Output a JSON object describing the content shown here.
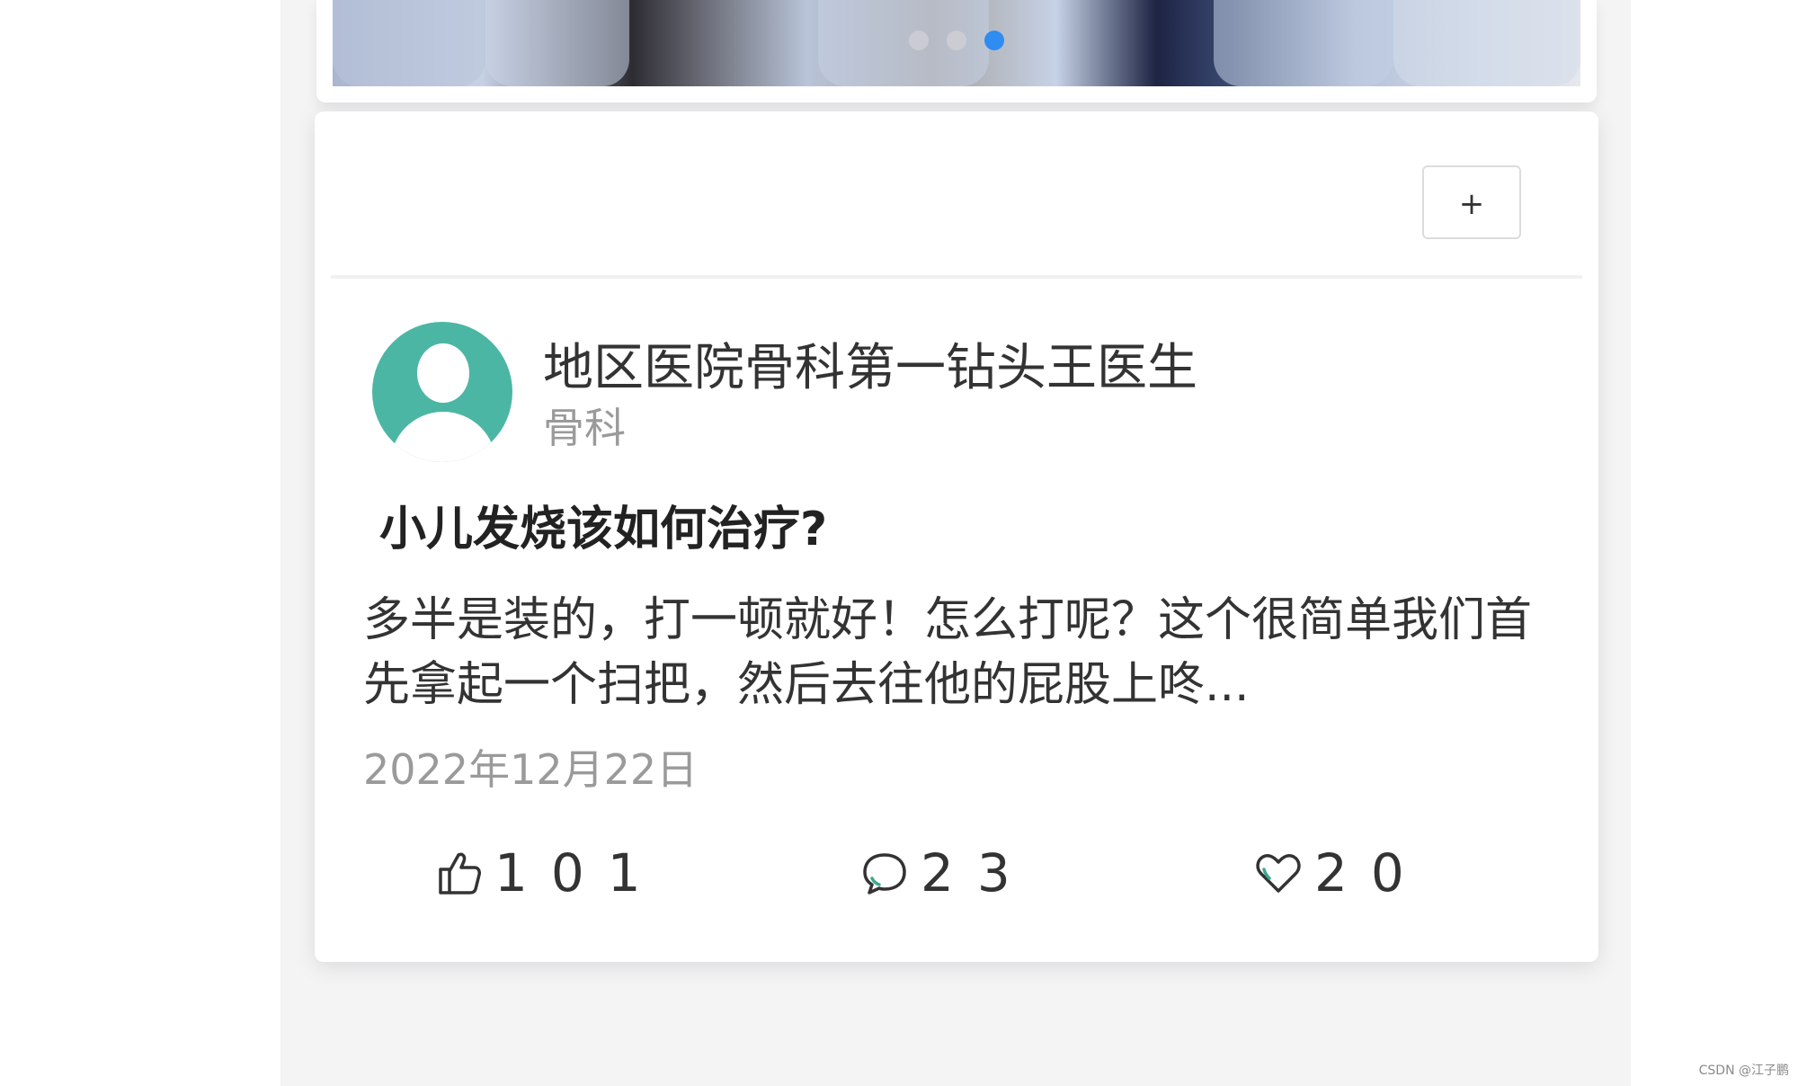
{
  "banner": {
    "slide_count": 3,
    "active_slide_index": 3
  },
  "toolbar": {
    "add_label": "+"
  },
  "post": {
    "author_name": "地区医院骨科第一钻头王医生",
    "department": "骨科",
    "title": "小儿发烧该如何治疗?",
    "excerpt": "多半是装的，打一顿就好！怎么打呢？这个很简单我们首先拿起一个扫把，然后去往他的屁股上咚...",
    "date": "2022年12月22日",
    "likes": "101",
    "comments": "23",
    "favorites": "20"
  },
  "icons": {
    "like": "thumbs-up-icon",
    "comment": "comment-bubble-icon",
    "favorite": "heart-icon"
  },
  "colors": {
    "avatar_bg": "#4cb6a4",
    "active_dot": "#2f8cf0",
    "accent_teal": "#3aa890"
  },
  "watermark": "CSDN @江子鹏"
}
